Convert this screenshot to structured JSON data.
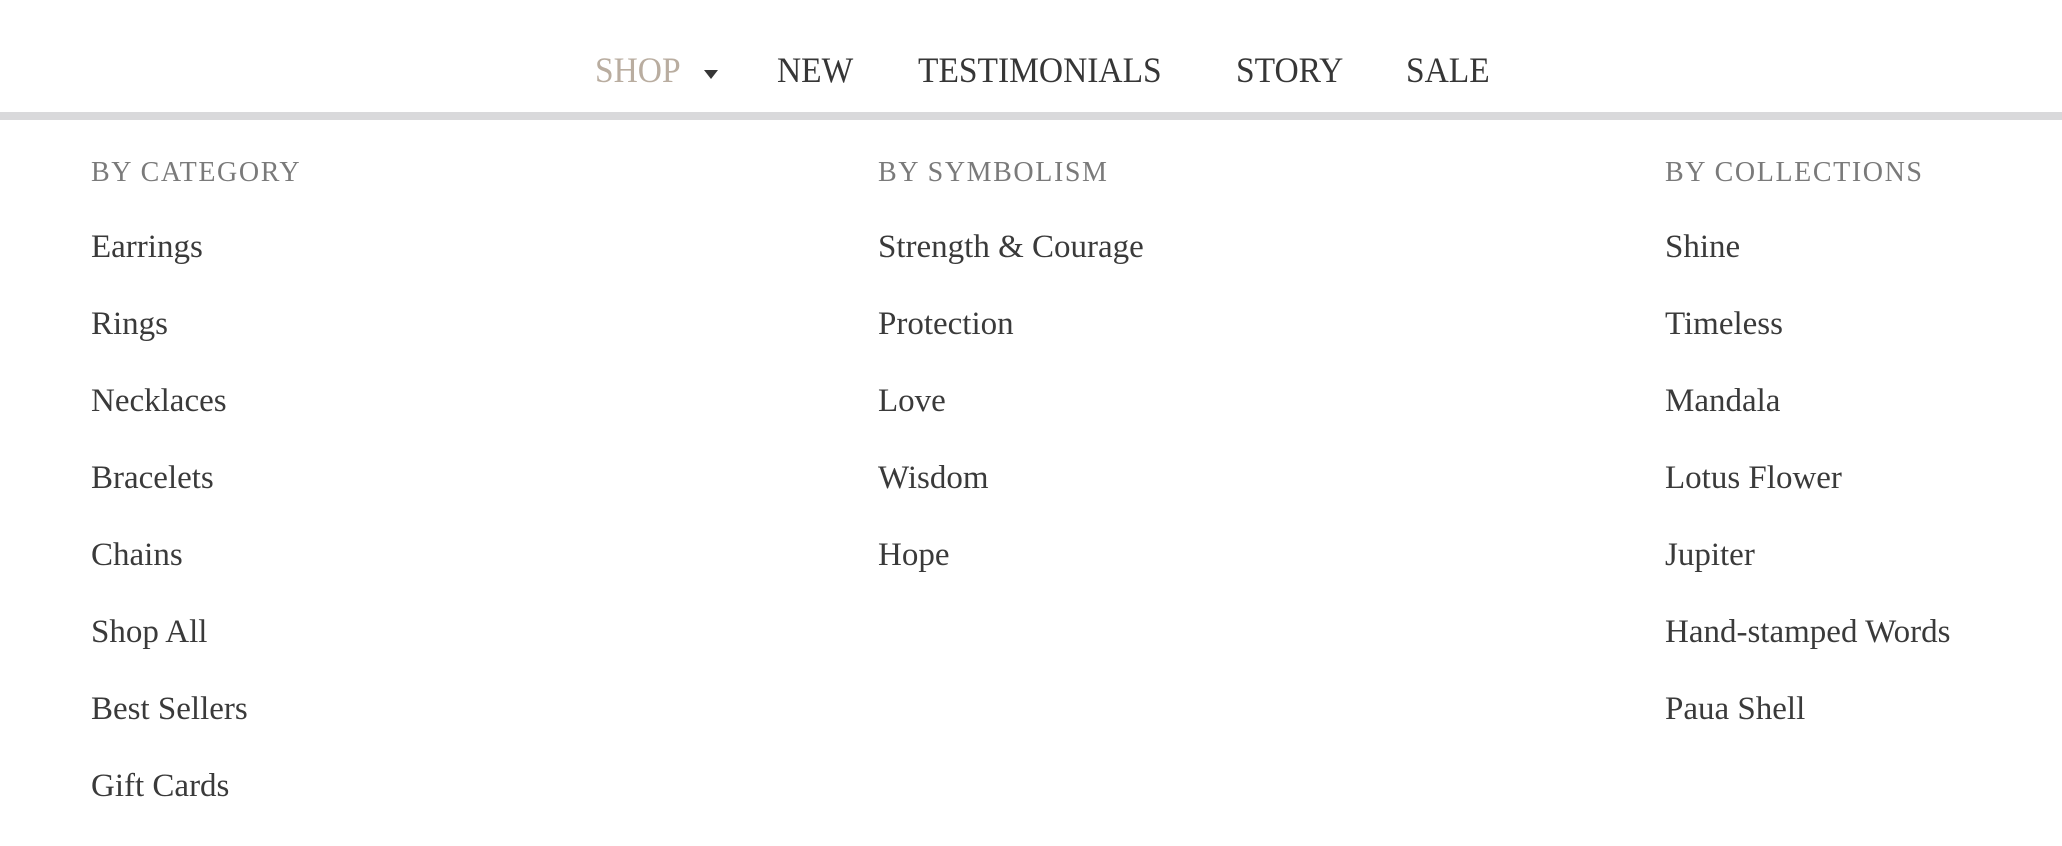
{
  "nav": {
    "items": [
      {
        "label": "SHOP",
        "active": true,
        "has_dropdown": true
      },
      {
        "label": "NEW"
      },
      {
        "label": "TESTIMONIALS"
      },
      {
        "label": "STORY"
      },
      {
        "label": "SALE"
      }
    ],
    "active_color": "#b9ada0",
    "text_color": "#363636"
  },
  "mega_menu": {
    "columns": [
      {
        "heading": "BY CATEGORY",
        "items": [
          "Earrings",
          "Rings",
          "Necklaces",
          "Bracelets",
          "Chains",
          "Shop All",
          "Best Sellers",
          "Gift Cards"
        ]
      },
      {
        "heading": "BY SYMBOLISM",
        "items": [
          "Strength & Courage",
          "Protection",
          "Love",
          "Wisdom",
          "Hope"
        ]
      },
      {
        "heading": "BY COLLECTIONS",
        "items": [
          "Shine",
          "Timeless",
          "Mandala",
          "Lotus Flower",
          "Jupiter",
          "Hand-stamped Words",
          "Paua Shell"
        ]
      }
    ]
  }
}
